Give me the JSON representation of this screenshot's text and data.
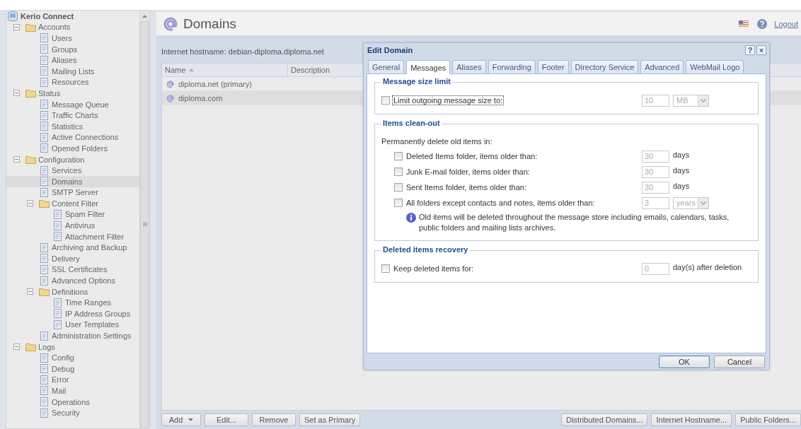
{
  "sidebar": {
    "title": "Kerio Connect",
    "tree": [
      {
        "label": "Accounts",
        "selected": false,
        "expanded": true,
        "children": [
          {
            "label": "Users",
            "selected": false
          },
          {
            "label": "Groups",
            "selected": false
          },
          {
            "label": "Aliases",
            "selected": false
          },
          {
            "label": "Mailing Lists",
            "selected": false
          },
          {
            "label": "Resources",
            "selected": false
          }
        ]
      },
      {
        "label": "Status",
        "selected": false,
        "expanded": true,
        "children": [
          {
            "label": "Message Queue",
            "selected": false
          },
          {
            "label": "Traffic Charts",
            "selected": false
          },
          {
            "label": "Statistics",
            "selected": false
          },
          {
            "label": "Active Connections",
            "selected": false
          },
          {
            "label": "Opened Folders",
            "selected": false
          }
        ]
      },
      {
        "label": "Configuration",
        "selected": false,
        "expanded": true,
        "children": [
          {
            "label": "Services",
            "selected": false
          },
          {
            "label": "Domains",
            "selected": true
          },
          {
            "label": "SMTP Server",
            "selected": false
          },
          {
            "label": "Content Filter",
            "selected": false,
            "expanded": true,
            "children": [
              {
                "label": "Spam Filter",
                "selected": false
              },
              {
                "label": "Antivirus",
                "selected": false
              },
              {
                "label": "Attachment Filter",
                "selected": false
              }
            ]
          },
          {
            "label": "Archiving and Backup",
            "selected": false
          },
          {
            "label": "Delivery",
            "selected": false
          },
          {
            "label": "SSL Certificates",
            "selected": false
          },
          {
            "label": "Advanced Options",
            "selected": false
          },
          {
            "label": "Definitions",
            "selected": false,
            "expanded": true,
            "children": [
              {
                "label": "Time Ranges",
                "selected": false
              },
              {
                "label": "IP Address Groups",
                "selected": false
              },
              {
                "label": "User Templates",
                "selected": false
              }
            ]
          },
          {
            "label": "Administration Settings",
            "selected": false
          }
        ]
      },
      {
        "label": "Logs",
        "selected": false,
        "expanded": true,
        "children": [
          {
            "label": "Config",
            "selected": false
          },
          {
            "label": "Debug",
            "selected": false
          },
          {
            "label": "Error",
            "selected": false
          },
          {
            "label": "Mail",
            "selected": false
          },
          {
            "label": "Operations",
            "selected": false
          },
          {
            "label": "Security",
            "selected": false
          }
        ]
      }
    ]
  },
  "page": {
    "title": "Domains",
    "logout": "Logout",
    "hostname": "Internet hostname: debian-diploma.diploma.net"
  },
  "table": {
    "columns": [
      {
        "label": "Name",
        "sorted_ascending": true
      },
      {
        "label": "Description",
        "sorted_ascending": false
      }
    ],
    "rows": [
      {
        "name": "diploma.net (primary)",
        "selected": false
      },
      {
        "name": "diploma.com",
        "selected": true
      }
    ]
  },
  "toolbar": {
    "left": [
      {
        "label": "Add",
        "dropdown": true
      },
      {
        "label": "Edit...",
        "dropdown": false
      },
      {
        "label": "Remove",
        "dropdown": false
      },
      {
        "label": "Set as Primary",
        "dropdown": false
      }
    ],
    "right": [
      {
        "label": "Distributed Domains..."
      },
      {
        "label": "Internet Hostname..."
      },
      {
        "label": "Public Folders..."
      }
    ]
  },
  "dialog": {
    "title": "Edit Domain",
    "title_buttons": [
      "?",
      "×"
    ],
    "tabs": [
      {
        "label": "General",
        "selected": false
      },
      {
        "label": "Messages",
        "selected": true
      },
      {
        "label": "Aliases",
        "selected": false
      },
      {
        "label": "Forwarding",
        "selected": false
      },
      {
        "label": "Footer",
        "selected": false
      },
      {
        "label": "Directory Service",
        "selected": false
      },
      {
        "label": "Advanced",
        "selected": false
      },
      {
        "label": "WebMail Logo",
        "selected": false
      }
    ],
    "sections": [
      {
        "title": "Message size limit",
        "rows": [
          {
            "kind": "option",
            "label": "Limit outgoing message size to:",
            "checked": false,
            "focused": true,
            "value": "10",
            "unit": "MB"
          }
        ]
      },
      {
        "title": "Items clean-out",
        "rows": [
          {
            "kind": "text",
            "text": "Permanently delete old items in:"
          },
          {
            "kind": "sub_option",
            "label": "Deleted Items folder, items older than:",
            "checked": false,
            "focused": false,
            "value": "30",
            "suffix": "days"
          },
          {
            "kind": "sub_option",
            "label": "Junk E-mail folder, items older than:",
            "checked": false,
            "focused": false,
            "value": "30",
            "suffix": "days"
          },
          {
            "kind": "sub_option",
            "label": "Sent Items folder, items older than:",
            "checked": false,
            "focused": false,
            "value": "30",
            "suffix": "days"
          },
          {
            "kind": "sub_option",
            "label": "All folders except contacts and notes, items older than:",
            "checked": false,
            "focused": false,
            "value": "3",
            "unit": "years"
          },
          {
            "kind": "note",
            "text": "Old items will be deleted throughout the message store including emails, calendars, tasks, public folders and mailing lists archives."
          }
        ]
      },
      {
        "title": "Deleted items recovery",
        "rows": [
          {
            "kind": "option",
            "label": "Keep deleted items for:",
            "checked": false,
            "focused": false,
            "value": "0",
            "suffix": "day(s) after deletion"
          }
        ]
      }
    ],
    "buttons": [
      {
        "label": "OK",
        "default": true
      },
      {
        "label": "Cancel",
        "default": false
      }
    ]
  }
}
